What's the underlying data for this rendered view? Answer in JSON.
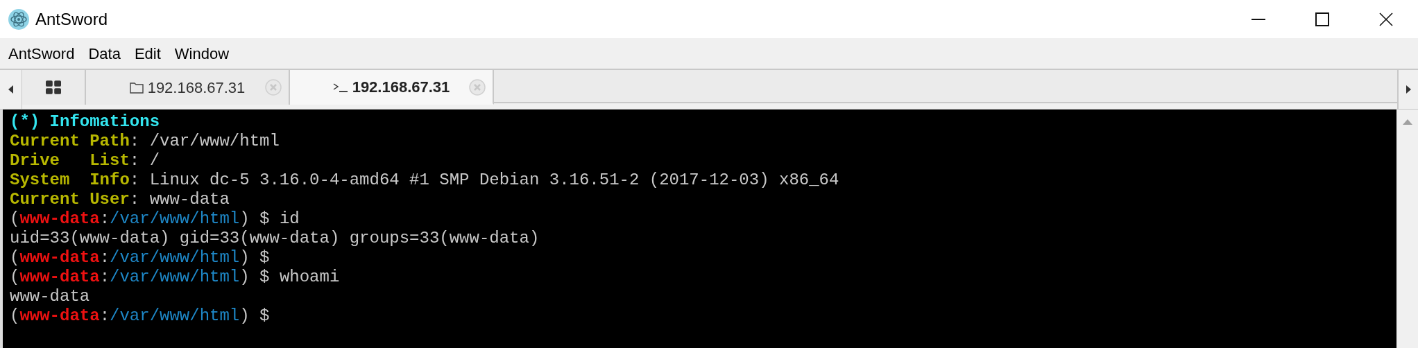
{
  "window": {
    "title": "AntSword"
  },
  "menu": [
    "AntSword",
    "Data",
    "Edit",
    "Window"
  ],
  "tabs": [
    {
      "kind": "home",
      "selected": false
    },
    {
      "kind": "files",
      "label": "192.168.67.31",
      "selected": false
    },
    {
      "kind": "terminal",
      "label": "192.168.67.31",
      "selected": true
    }
  ],
  "terminal": {
    "lines": [
      [
        {
          "kind": "heading",
          "text": "(*) Infomations"
        }
      ],
      [
        {
          "kind": "label",
          "text": "Current Path"
        },
        {
          "kind": "plain",
          "text": ": /var/www/html"
        }
      ],
      [
        {
          "kind": "label",
          "text": "Drive   List"
        },
        {
          "kind": "plain",
          "text": ": /"
        }
      ],
      [
        {
          "kind": "label",
          "text": "System  Info"
        },
        {
          "kind": "plain",
          "text": ": Linux dc-5 3.16.0-4-amd64 #1 SMP Debian 3.16.51-2 (2017-12-03) x86_64"
        }
      ],
      [
        {
          "kind": "label",
          "text": "Current User"
        },
        {
          "kind": "plain",
          "text": ": www-data"
        }
      ],
      [
        {
          "kind": "plain",
          "text": "("
        },
        {
          "kind": "user",
          "text": "www-data"
        },
        {
          "kind": "plain",
          "text": ":"
        },
        {
          "kind": "path",
          "text": "/var/www/html"
        },
        {
          "kind": "plain",
          "text": ") $ id"
        }
      ],
      [
        {
          "kind": "plain",
          "text": "uid=33(www-data) gid=33(www-data) groups=33(www-data)"
        }
      ],
      [
        {
          "kind": "plain",
          "text": "("
        },
        {
          "kind": "user",
          "text": "www-data"
        },
        {
          "kind": "plain",
          "text": ":"
        },
        {
          "kind": "path",
          "text": "/var/www/html"
        },
        {
          "kind": "plain",
          "text": ") $"
        }
      ],
      [
        {
          "kind": "plain",
          "text": "("
        },
        {
          "kind": "user",
          "text": "www-data"
        },
        {
          "kind": "plain",
          "text": ":"
        },
        {
          "kind": "path",
          "text": "/var/www/html"
        },
        {
          "kind": "plain",
          "text": ") $ whoami"
        }
      ],
      [
        {
          "kind": "plain",
          "text": "www-data"
        }
      ],
      [
        {
          "kind": "plain",
          "text": "("
        },
        {
          "kind": "user",
          "text": "www-data"
        },
        {
          "kind": "plain",
          "text": ":"
        },
        {
          "kind": "path",
          "text": "/var/www/html"
        },
        {
          "kind": "plain",
          "text": ") $"
        }
      ]
    ]
  }
}
